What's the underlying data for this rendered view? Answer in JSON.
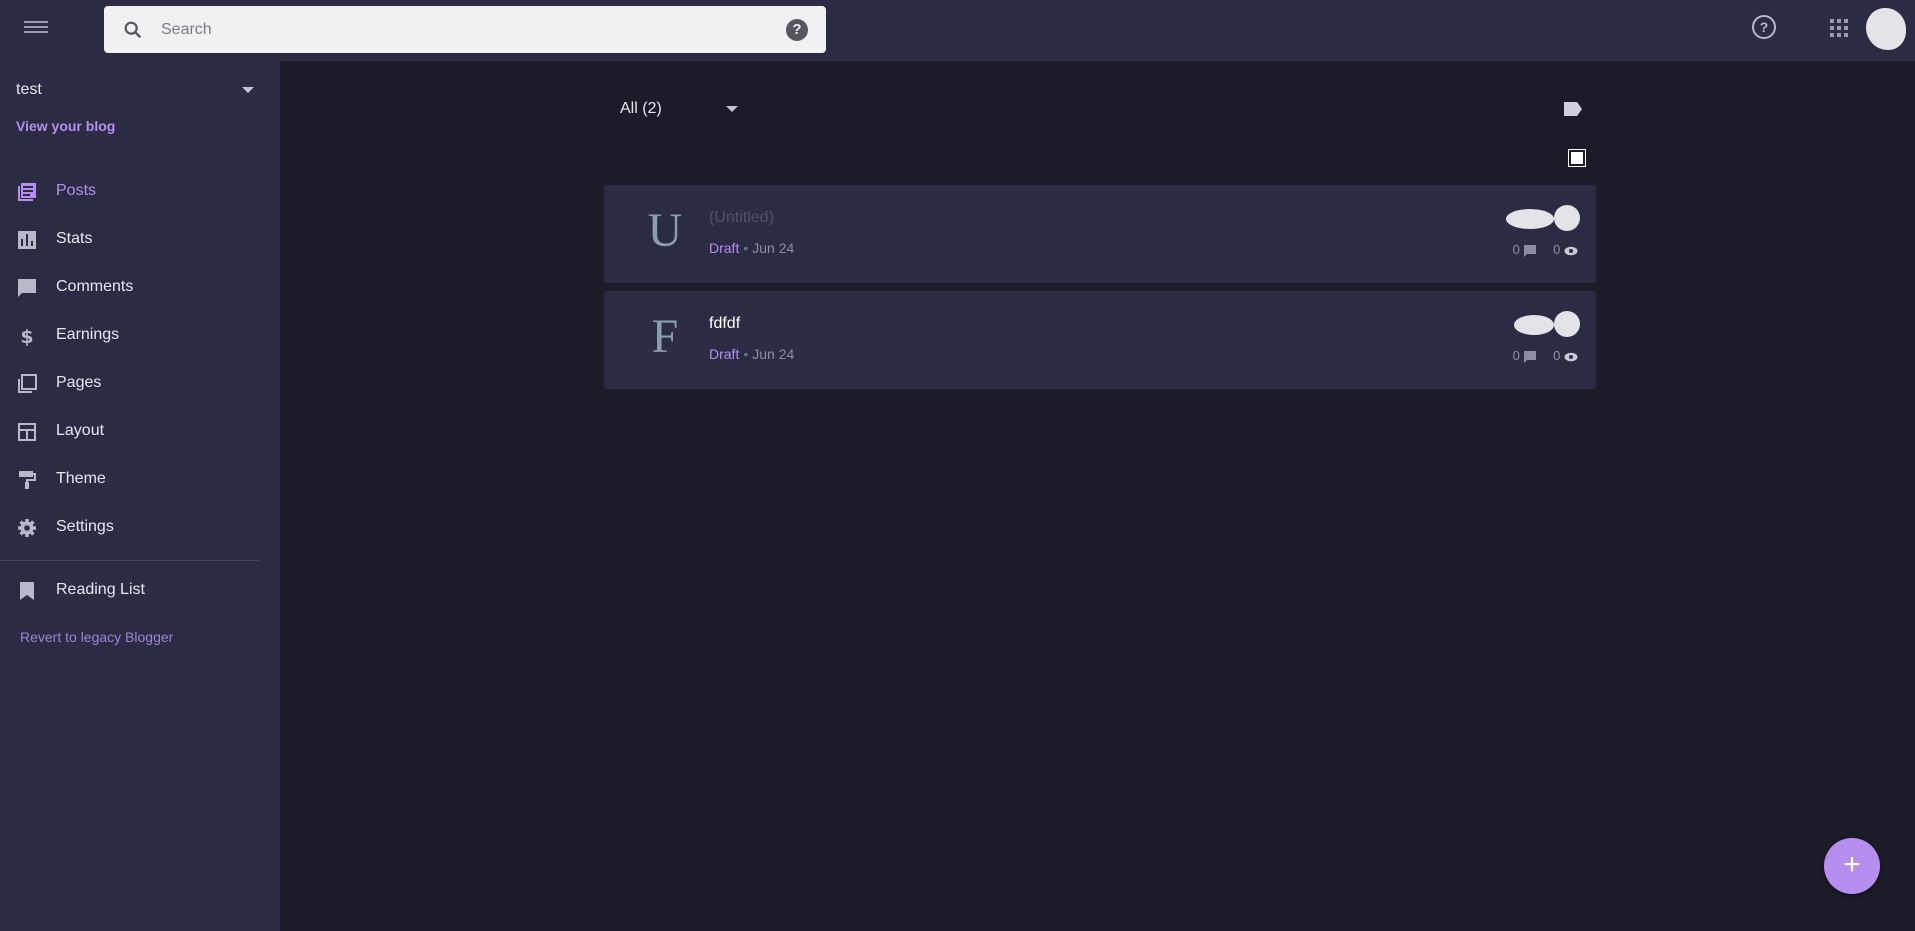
{
  "search": {
    "placeholder": "Search"
  },
  "sidebar": {
    "blog_name": "test",
    "view_blog": "View your blog",
    "items": [
      {
        "label": "Posts",
        "icon": "posts-icon"
      },
      {
        "label": "Stats",
        "icon": "stats-icon"
      },
      {
        "label": "Comments",
        "icon": "comments-icon"
      },
      {
        "label": "Earnings",
        "icon": "dollar-icon"
      },
      {
        "label": "Pages",
        "icon": "pages-icon"
      },
      {
        "label": "Layout",
        "icon": "layout-icon"
      },
      {
        "label": "Theme",
        "icon": "paint-roller-icon"
      },
      {
        "label": "Settings",
        "icon": "gear-icon"
      }
    ],
    "reading_list": "Reading List",
    "revert": "Revert to legacy Blogger"
  },
  "filter": {
    "label": "All (2)"
  },
  "posts": [
    {
      "letter": "U",
      "title": "(Untitled)",
      "status": "Draft",
      "date": "Jun 24",
      "comments": "0",
      "views": "0"
    },
    {
      "letter": "F",
      "title": "fdfdf",
      "status": "Draft",
      "date": "Jun 24",
      "comments": "0",
      "views": "0"
    }
  ],
  "fab": {
    "label": "+"
  },
  "colors": {
    "accent": "#b58ef0",
    "sidebar_bg": "#2b2c44",
    "main_bg": "#1b1c28"
  }
}
